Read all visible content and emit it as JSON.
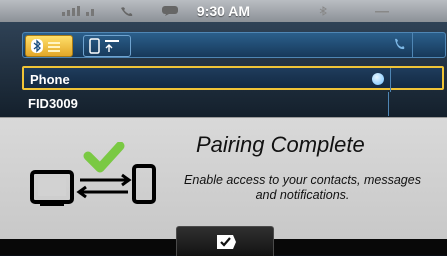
{
  "status_bar": {
    "time": "9:30 AM",
    "icons": [
      "signal-icon",
      "handset-icon",
      "message-icon",
      "bluetooth-icon"
    ]
  },
  "source_tabs": {
    "tabs": [
      {
        "name": "bluetooth-audio",
        "icon": "bluetooth-icon",
        "selected": true
      },
      {
        "name": "phone-source",
        "icon": "phone-icon",
        "selected": false
      }
    ],
    "call_icon": "call-icon"
  },
  "device_list": {
    "items": [
      {
        "label": "Phone",
        "selected": true,
        "connected": true
      },
      {
        "label": "FID3009",
        "selected": false,
        "connected": false
      }
    ]
  },
  "dialog": {
    "title": "Pairing Complete",
    "body_line1": "Enable access to your contacts, messages",
    "body_line2": "and notifications.",
    "illustration": "pairing-illustration",
    "confirm_icon": "checkmark-icon"
  },
  "colors": {
    "accent_yellow": "#f0c437",
    "check_green": "#7ac943",
    "dialog_bg": "#d2d2d2",
    "screen_blue": "#1f3c5c"
  }
}
